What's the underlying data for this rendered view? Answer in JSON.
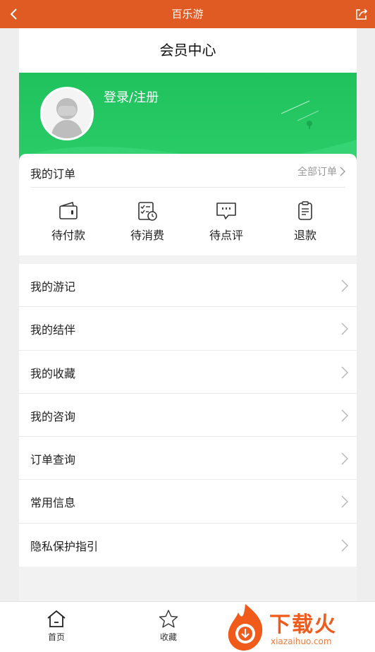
{
  "topbar": {
    "title": "百乐游",
    "back_icon": "chevron-left-icon",
    "share_icon": "share-icon",
    "color": "#e05a24"
  },
  "page": {
    "title": "会员中心"
  },
  "profile": {
    "login_label": "登录/注册",
    "banner_color": "#21c15e"
  },
  "orders": {
    "title": "我的订单",
    "all_label": "全部订单",
    "items": [
      {
        "label": "待付款",
        "icon": "wallet-icon"
      },
      {
        "label": "待消费",
        "icon": "checklist-clock-icon"
      },
      {
        "label": "待点评",
        "icon": "comment-icon"
      },
      {
        "label": "退款",
        "icon": "refund-clipboard-icon"
      }
    ]
  },
  "menu": {
    "items": [
      {
        "label": "我的游记"
      },
      {
        "label": "我的结伴"
      },
      {
        "label": "我的收藏"
      },
      {
        "label": "我的咨询"
      },
      {
        "label": "订单查询"
      },
      {
        "label": "常用信息"
      },
      {
        "label": "隐私保护指引"
      }
    ]
  },
  "tabbar": {
    "items": [
      {
        "label": "首页",
        "icon": "home-icon"
      },
      {
        "label": "收藏",
        "icon": "star-icon"
      }
    ]
  },
  "watermark": {
    "text": "下载火",
    "url": "xiazaihuo.com",
    "color": "#f05a1a"
  }
}
